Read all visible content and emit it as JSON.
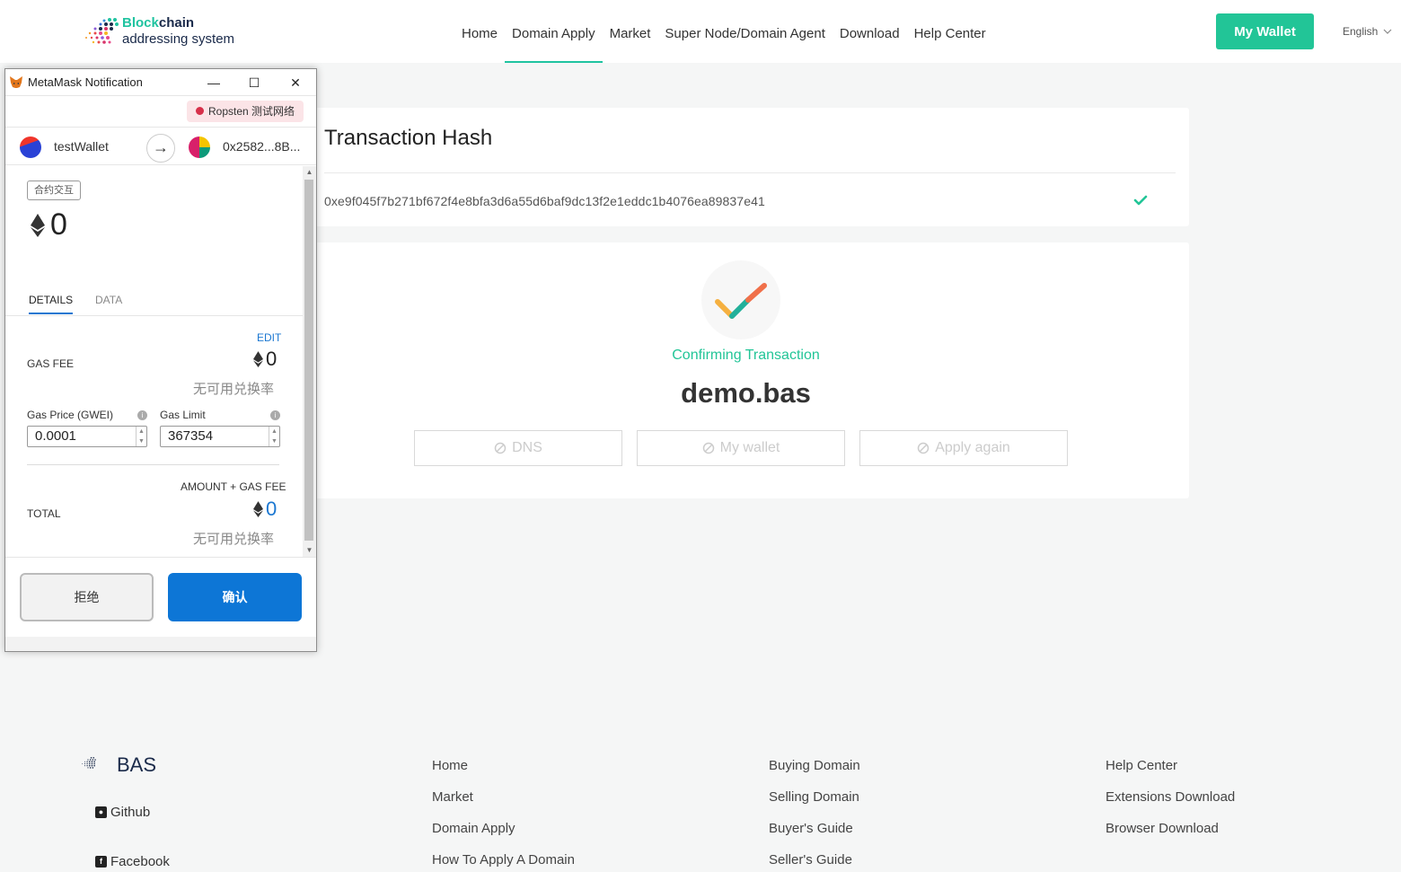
{
  "header": {
    "logo_line1_accent": "Block",
    "logo_line1_rest": "chain",
    "logo_line2": "addressing system",
    "nav": [
      {
        "label": "Home"
      },
      {
        "label": "Domain Apply"
      },
      {
        "label": "Market"
      },
      {
        "label": "Super Node/Domain Agent"
      },
      {
        "label": "Download"
      },
      {
        "label": "Help Center"
      }
    ],
    "active_nav": "Domain Apply",
    "wallet_button": "My Wallet",
    "language": "English"
  },
  "transaction": {
    "title": "Transaction Hash",
    "hash": "0xe9f045f7b271bf672f4e8bfa3d6a55d6baf9dc13f2e1eddc1b4076ea89837e41",
    "status_icon": "check-icon"
  },
  "confirmation": {
    "status": "Confirming Transaction",
    "domain": "demo.bas",
    "buttons": [
      {
        "label": "DNS",
        "icon": "ban-icon"
      },
      {
        "label": "My wallet",
        "icon": "ban-icon"
      },
      {
        "label": "Apply again",
        "icon": "ban-icon"
      }
    ]
  },
  "footer": {
    "brand": "BAS",
    "social": [
      {
        "label": "Github",
        "icon": "github-icon"
      },
      {
        "label": "Facebook",
        "icon": "facebook-icon"
      }
    ],
    "col1": [
      "Home",
      "Market",
      "Domain Apply",
      "How To Apply A Domain"
    ],
    "col2": [
      "Buying Domain",
      "Selling Domain",
      "Buyer's Guide",
      "Seller's Guide"
    ],
    "col3": [
      "Help Center",
      "Extensions Download",
      "Browser Download"
    ]
  },
  "metamask": {
    "window_title": "MetaMask Notification",
    "network": "Ropsten 测试网络",
    "from_account": "testWallet",
    "to_account": "0x2582...8B...",
    "tag": "合约交互",
    "amount": "0",
    "tabs": [
      "DETAILS",
      "DATA"
    ],
    "active_tab": "DETAILS",
    "edit_label": "EDIT",
    "gas_fee_label": "GAS FEE",
    "gas_fee_value": "0",
    "no_rate": "无可用兑换率",
    "gas_price_label": "Gas Price (GWEI)",
    "gas_price_value": "0.0001",
    "gas_limit_label": "Gas Limit",
    "gas_limit_value": "367354",
    "amount_gas_label": "AMOUNT + GAS FEE",
    "total_label": "TOTAL",
    "total_value": "0",
    "total_rate": "无可用兑换率",
    "reject_button": "拒绝",
    "confirm_button": "确认",
    "accent_color": "#0d76d6"
  },
  "colors": {
    "brand": "#22c597",
    "background": "#f5f6f6"
  }
}
